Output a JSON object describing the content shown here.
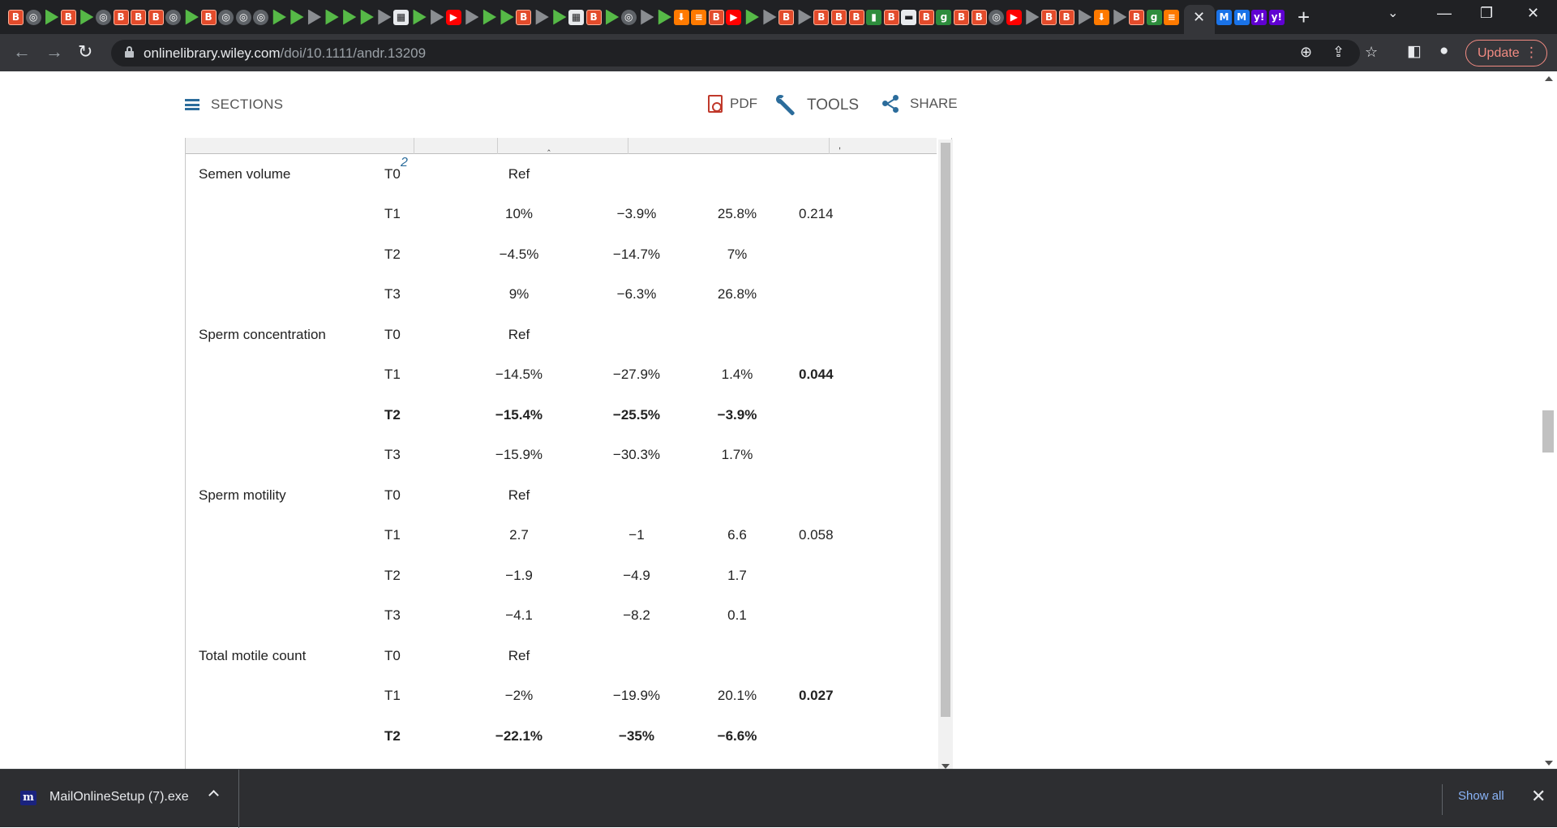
{
  "browser": {
    "favicons": [
      {
        "kind": "b",
        "glyph": "B"
      },
      {
        "kind": "c",
        "glyph": "◎"
      },
      {
        "kind": "gp",
        "glyph": ""
      },
      {
        "kind": "b",
        "glyph": "B"
      },
      {
        "kind": "gp",
        "glyph": ""
      },
      {
        "kind": "c",
        "glyph": "◎"
      },
      {
        "kind": "b",
        "glyph": "B"
      },
      {
        "kind": "b",
        "glyph": "B"
      },
      {
        "kind": "b",
        "glyph": "B"
      },
      {
        "kind": "c",
        "glyph": "◎"
      },
      {
        "kind": "gp",
        "glyph": ""
      },
      {
        "kind": "b",
        "glyph": "B"
      },
      {
        "kind": "c",
        "glyph": "◎"
      },
      {
        "kind": "c",
        "glyph": "◎"
      },
      {
        "kind": "c",
        "glyph": "◎"
      },
      {
        "kind": "gp",
        "glyph": ""
      },
      {
        "kind": "gp",
        "glyph": ""
      },
      {
        "kind": "gr",
        "glyph": ""
      },
      {
        "kind": "gp",
        "glyph": ""
      },
      {
        "kind": "gp",
        "glyph": ""
      },
      {
        "kind": "gp",
        "glyph": ""
      },
      {
        "kind": "gr",
        "glyph": ""
      },
      {
        "kind": "w",
        "glyph": "▦"
      },
      {
        "kind": "gp",
        "glyph": ""
      },
      {
        "kind": "gr",
        "glyph": ""
      },
      {
        "kind": "y",
        "glyph": "▶"
      },
      {
        "kind": "gr",
        "glyph": ""
      },
      {
        "kind": "gp",
        "glyph": ""
      },
      {
        "kind": "gp",
        "glyph": ""
      },
      {
        "kind": "b",
        "glyph": "B"
      },
      {
        "kind": "gr",
        "glyph": ""
      },
      {
        "kind": "gp",
        "glyph": ""
      },
      {
        "kind": "w",
        "glyph": "▦"
      },
      {
        "kind": "b",
        "glyph": "B"
      },
      {
        "kind": "gp",
        "glyph": ""
      },
      {
        "kind": "c",
        "glyph": "◎"
      },
      {
        "kind": "gr",
        "glyph": ""
      },
      {
        "kind": "gp",
        "glyph": ""
      },
      {
        "kind": "o",
        "glyph": "⬇"
      },
      {
        "kind": "o",
        "glyph": "≡"
      },
      {
        "kind": "b",
        "glyph": "B"
      },
      {
        "kind": "y",
        "glyph": "▶"
      },
      {
        "kind": "gp",
        "glyph": ""
      },
      {
        "kind": "gr",
        "glyph": ""
      },
      {
        "kind": "b",
        "glyph": "B"
      },
      {
        "kind": "gr",
        "glyph": ""
      },
      {
        "kind": "b",
        "glyph": "B"
      },
      {
        "kind": "b",
        "glyph": "B"
      },
      {
        "kind": "b",
        "glyph": "B"
      },
      {
        "kind": "g",
        "glyph": "▮"
      },
      {
        "kind": "b",
        "glyph": "B"
      },
      {
        "kind": "w",
        "glyph": "▬"
      },
      {
        "kind": "b",
        "glyph": "B"
      },
      {
        "kind": "g",
        "glyph": "g"
      },
      {
        "kind": "b",
        "glyph": "B"
      },
      {
        "kind": "b",
        "glyph": "B"
      },
      {
        "kind": "c",
        "glyph": "◎"
      },
      {
        "kind": "y",
        "glyph": "▶"
      },
      {
        "kind": "gr",
        "glyph": ""
      },
      {
        "kind": "b",
        "glyph": "B"
      },
      {
        "kind": "b",
        "glyph": "B"
      },
      {
        "kind": "gr",
        "glyph": ""
      },
      {
        "kind": "o",
        "glyph": "⬇"
      },
      {
        "kind": "gr",
        "glyph": ""
      },
      {
        "kind": "b",
        "glyph": "B"
      },
      {
        "kind": "g",
        "glyph": "g"
      },
      {
        "kind": "o",
        "glyph": "≡"
      }
    ],
    "after_active_favicons": [
      {
        "kind": "bl",
        "glyph": "M"
      },
      {
        "kind": "bl",
        "glyph": "M"
      },
      {
        "kind": "p",
        "glyph": "y!"
      },
      {
        "kind": "p",
        "glyph": "y!"
      }
    ],
    "url_host": "onlinelibrary.wiley.com",
    "url_path": "/doi/10.1111/andr.13209",
    "update_label": "Update"
  },
  "article_toolbar": {
    "sections_label": "SECTIONS",
    "pdf_label": "PDF",
    "tools_label": "TOOLS",
    "share_label": "SHARE"
  },
  "table": {
    "footnote_ref": "2",
    "rows": [
      {
        "variable": "Semen volume",
        "time": "T0",
        "estimate": "Ref",
        "lower": "",
        "upper": "",
        "p": "",
        "bold": false,
        "p_bold": false
      },
      {
        "variable": "",
        "time": "T1",
        "estimate": "10%",
        "lower": "−3.9%",
        "upper": "25.8%",
        "p": "0.214",
        "bold": false,
        "p_bold": false
      },
      {
        "variable": "",
        "time": "T2",
        "estimate": "−4.5%",
        "lower": "−14.7%",
        "upper": "7%",
        "p": "",
        "bold": false,
        "p_bold": false
      },
      {
        "variable": "",
        "time": "T3",
        "estimate": "9%",
        "lower": "−6.3%",
        "upper": "26.8%",
        "p": "",
        "bold": false,
        "p_bold": false
      },
      {
        "variable": "Sperm concentration",
        "time": "T0",
        "estimate": "Ref",
        "lower": "",
        "upper": "",
        "p": "",
        "bold": false,
        "p_bold": false
      },
      {
        "variable": "",
        "time": "T1",
        "estimate": "−14.5%",
        "lower": "−27.9%",
        "upper": "1.4%",
        "p": "0.044",
        "bold": false,
        "p_bold": true
      },
      {
        "variable": "",
        "time": "T2",
        "estimate": "−15.4%",
        "lower": "−25.5%",
        "upper": "−3.9%",
        "p": "",
        "bold": true,
        "p_bold": false
      },
      {
        "variable": "",
        "time": "T3",
        "estimate": "−15.9%",
        "lower": "−30.3%",
        "upper": "1.7%",
        "p": "",
        "bold": false,
        "p_bold": false
      },
      {
        "variable": "Sperm motility",
        "time": "T0",
        "estimate": "Ref",
        "lower": "",
        "upper": "",
        "p": "",
        "bold": false,
        "p_bold": false
      },
      {
        "variable": "",
        "time": "T1",
        "estimate": "2.7",
        "lower": "−1",
        "upper": "6.6",
        "p": "0.058",
        "bold": false,
        "p_bold": false
      },
      {
        "variable": "",
        "time": "T2",
        "estimate": "−1.9",
        "lower": "−4.9",
        "upper": "1.7",
        "p": "",
        "bold": false,
        "p_bold": false
      },
      {
        "variable": "",
        "time": "T3",
        "estimate": "−4.1",
        "lower": "−8.2",
        "upper": "0.1",
        "p": "",
        "bold": false,
        "p_bold": false
      },
      {
        "variable": "Total motile count",
        "time": "T0",
        "estimate": "Ref",
        "lower": "",
        "upper": "",
        "p": "",
        "bold": false,
        "p_bold": false
      },
      {
        "variable": "",
        "time": "T1",
        "estimate": "−2%",
        "lower": "−19.9%",
        "upper": "20.1%",
        "p": "0.027",
        "bold": false,
        "p_bold": true
      },
      {
        "variable": "",
        "time": "T2",
        "estimate": "−22.1%",
        "lower": "−35%",
        "upper": "−6.6%",
        "p": "",
        "bold": true,
        "p_bold": false
      }
    ]
  },
  "downloads": {
    "icon_glyph": "m",
    "file_name": "MailOnlineSetup (7).exe",
    "show_all_label": "Show all"
  }
}
